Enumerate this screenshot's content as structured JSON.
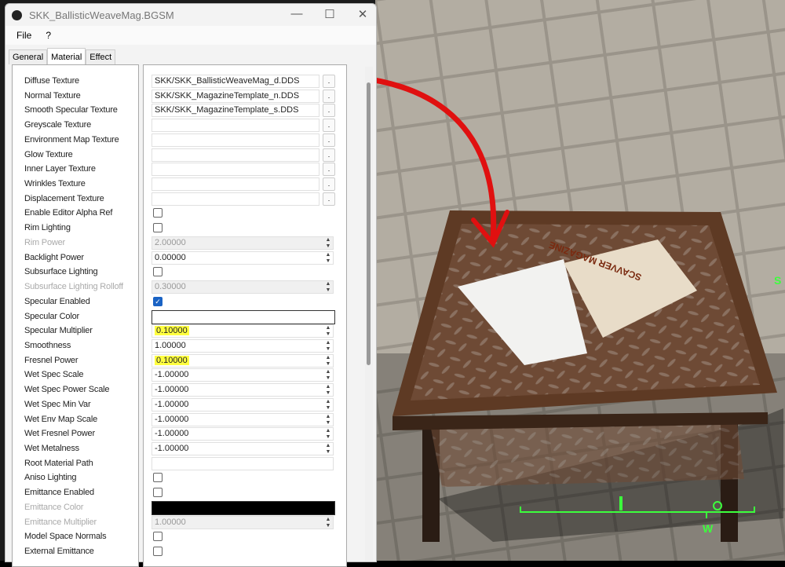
{
  "window": {
    "title": "SKK_BallisticWeaveMag.BGSM",
    "minimize": "—",
    "maximize": "☐",
    "close": "✕"
  },
  "menu": [
    "File",
    "?"
  ],
  "tabs": [
    {
      "label": "General",
      "active": false
    },
    {
      "label": "Material",
      "active": true
    },
    {
      "label": "Effect",
      "active": false
    }
  ],
  "rows": [
    {
      "label": "Diffuse Texture",
      "type": "texture",
      "value": "SKK/SKK_BallisticWeaveMag_d.DDS"
    },
    {
      "label": "Normal Texture",
      "type": "texture",
      "value": "SKK/SKK_MagazineTemplate_n.DDS"
    },
    {
      "label": "Smooth Specular Texture",
      "type": "texture",
      "value": "SKK/SKK_MagazineTemplate_s.DDS"
    },
    {
      "label": "Greyscale Texture",
      "type": "texture",
      "value": ""
    },
    {
      "label": "Environment Map Texture",
      "type": "texture",
      "value": ""
    },
    {
      "label": "Glow Texture",
      "type": "texture",
      "value": ""
    },
    {
      "label": "Inner Layer Texture",
      "type": "texture",
      "value": ""
    },
    {
      "label": "Wrinkles Texture",
      "type": "texture",
      "value": ""
    },
    {
      "label": "Displacement Texture",
      "type": "texture",
      "value": ""
    },
    {
      "label": "Enable Editor Alpha Ref",
      "type": "check",
      "checked": false
    },
    {
      "label": "Rim Lighting",
      "type": "check",
      "checked": false
    },
    {
      "label": "Rim Power",
      "type": "spin",
      "value": "2.00000",
      "disabled": true
    },
    {
      "label": "Backlight Power",
      "type": "spin",
      "value": "0.00000"
    },
    {
      "label": "Subsurface Lighting",
      "type": "check",
      "checked": false
    },
    {
      "label": "Subsurface Lighting Rolloff",
      "type": "spin",
      "value": "0.30000",
      "disabled": true
    },
    {
      "label": "Specular Enabled",
      "type": "check",
      "checked": true
    },
    {
      "label": "Specular Color",
      "type": "color",
      "color": "#ffffff"
    },
    {
      "label": "Specular Multiplier",
      "type": "spin",
      "value": "0.10000",
      "highlight": true
    },
    {
      "label": "Smoothness",
      "type": "spin",
      "value": "1.00000"
    },
    {
      "label": "Fresnel Power",
      "type": "spin",
      "value": "0.10000",
      "highlight": true
    },
    {
      "label": "Wet Spec Scale",
      "type": "spin",
      "value": "-1.00000"
    },
    {
      "label": "Wet Spec Power Scale",
      "type": "spin",
      "value": "-1.00000"
    },
    {
      "label": "Wet Spec Min Var",
      "type": "spin",
      "value": "-1.00000"
    },
    {
      "label": "Wet Env Map Scale",
      "type": "spin",
      "value": "-1.00000"
    },
    {
      "label": "Wet Fresnel Power",
      "type": "spin",
      "value": "-1.00000"
    },
    {
      "label": "Wet Metalness",
      "type": "spin",
      "value": "-1.00000"
    },
    {
      "label": "Root Material Path",
      "type": "text",
      "value": ""
    },
    {
      "label": "Aniso Lighting",
      "type": "check",
      "checked": false
    },
    {
      "label": "Emittance Enabled",
      "type": "check",
      "checked": false
    },
    {
      "label": "Emittance Color",
      "type": "color",
      "color": "#000000",
      "disabled": true
    },
    {
      "label": "Emittance Multiplier",
      "type": "spin",
      "value": "1.00000",
      "disabled": true
    },
    {
      "label": "Model Space Normals",
      "type": "check",
      "checked": false
    },
    {
      "label": "External Emittance",
      "type": "check",
      "checked": false
    }
  ],
  "game": {
    "compass_marker": "W",
    "hud_color": "#3cff3c",
    "arrow_color": "#e01010",
    "magazine_text": "SCAVVER MAGAZINE"
  }
}
